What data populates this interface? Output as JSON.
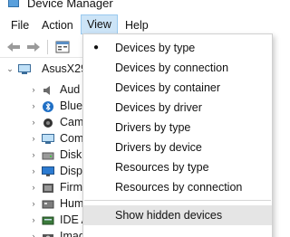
{
  "window": {
    "title": "Device Manager"
  },
  "menubar": {
    "items": [
      "File",
      "Action",
      "View",
      "Help"
    ],
    "active": "View"
  },
  "toolbar": {
    "icons": [
      "back-arrow-icon",
      "forward-arrow-icon",
      "properties-icon"
    ]
  },
  "tree": {
    "root": "AsusX29",
    "items": [
      "Aud",
      "Blue",
      "Cam",
      "Com",
      "Disk",
      "Disp",
      "Firm",
      "Hum",
      "IDE A",
      "Imag"
    ]
  },
  "view_menu": {
    "items": [
      {
        "label": "Devices by type",
        "checked": true
      },
      {
        "label": "Devices by connection",
        "checked": false
      },
      {
        "label": "Devices by container",
        "checked": false
      },
      {
        "label": "Devices by driver",
        "checked": false
      },
      {
        "label": "Drivers by type",
        "checked": false
      },
      {
        "label": "Drivers by device",
        "checked": false
      },
      {
        "label": "Resources by type",
        "checked": false
      },
      {
        "label": "Resources by connection",
        "checked": false
      },
      {
        "label": "Show hidden devices",
        "checked": false,
        "hovered": true
      }
    ]
  }
}
